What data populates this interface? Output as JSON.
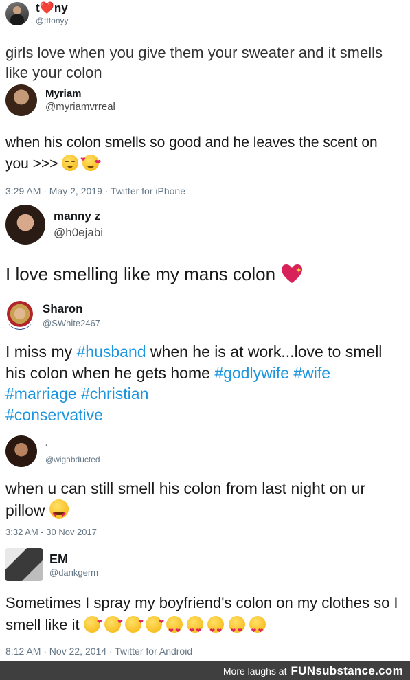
{
  "tweets": [
    {
      "name": "t❤️ny",
      "handle": "@tttonyy",
      "text": "girls love when you give them your sweater and it smells like your colon"
    },
    {
      "name": "Myriam",
      "handle": "@myriamvrreal",
      "text": "when his colon smells so good and he leaves the scent on you >>>",
      "timestamp": "3:29 AM · May 2, 2019 · Twitter for iPhone"
    },
    {
      "name": "manny z",
      "handle": "@h0ejabi",
      "text": "I love smelling like my mans colon"
    },
    {
      "name": "Sharon",
      "handle": "@SWhite2467",
      "text_before": "I miss my ",
      "tag_husband": "#husband",
      "text_after": " when he is at work...love to smell his colon when he gets home",
      "hashtags": [
        "#godlywife",
        "#wife",
        "#marriage",
        "#christian",
        "#conservative"
      ]
    },
    {
      "name": ".",
      "handle": "@wigabducted",
      "text": "when u can still smell his colon from last night on ur pillow",
      "timestamp": "3:32 AM - 30 Nov 2017"
    },
    {
      "name": "EM",
      "handle": "@dankgerm",
      "text": "Sometimes I spray my boyfriend's colon on my clothes so I smell like it",
      "timestamp": "8:12 AM · Nov 22, 2014 · Twitter for Android"
    }
  ],
  "footer": {
    "prefix": "More laughs at",
    "brand": "FUNsubstance.com"
  },
  "colors": {
    "hashtag": "#1b95e0",
    "footer_bg": "#3f3f3f",
    "meta": "#657786"
  },
  "icons": [
    "relieved-face-emoji",
    "smiling-face-with-hearts-emoji",
    "sparkling-heart-emoji",
    "face-blowing-kiss-emoji",
    "heart-eyes-emoji"
  ]
}
